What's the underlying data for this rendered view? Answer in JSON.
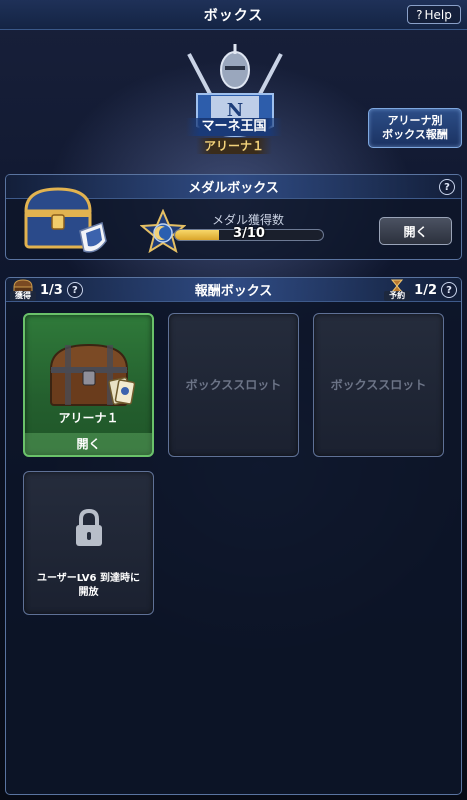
{
  "header": {
    "title": "ボックス",
    "help_label": "Help"
  },
  "kingdom": {
    "name": "マーネ王国",
    "arena": "アリーナ１"
  },
  "arena_reward_button": {
    "line1": "アリーナ別",
    "line2": "ボックス報酬"
  },
  "medal_box": {
    "title": "メダルボックス",
    "label": "メダル獲得数",
    "progress_text": "3/10",
    "progress_fraction": 0.3,
    "open_label": "開く"
  },
  "reward_box": {
    "title": "報酬ボックス",
    "acquired_tag": "獲得",
    "acquired_count": "1/3",
    "reserve_tag": "予約",
    "reserve_count": "1/2",
    "slots": [
      {
        "arena": "アリーナ１",
        "open_label": "開く"
      },
      {
        "text": "ボックススロット"
      },
      {
        "text": "ボックススロット"
      },
      {
        "lock_line1": "ユーザーLV6 到達時に",
        "lock_line2": "開放"
      }
    ]
  },
  "colors": {
    "accent_gold": "#f3d27a",
    "active_green": "#2f7a3a",
    "panel_border": "#5a74a0"
  }
}
